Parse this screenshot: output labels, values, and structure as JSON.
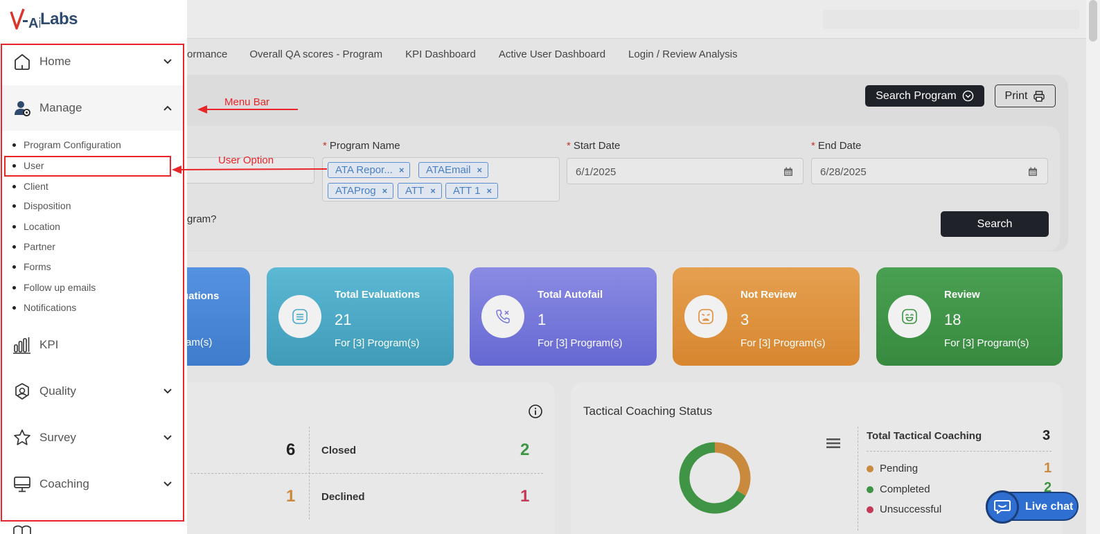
{
  "logo": {
    "text": "V-AiLabs"
  },
  "tabs": [
    "ormance",
    "Overall QA scores - Program",
    "KPI Dashboard",
    "Active User Dashboard",
    "Login / Review Analysis"
  ],
  "toolbar": {
    "search_program_label": "Search Program",
    "print_label": "Print"
  },
  "filters": {
    "program_name_label": "Program Name",
    "start_date_label": "Start Date",
    "end_date_label": "End Date",
    "start_date_value": "6/1/2025",
    "end_date_value": "6/28/2025",
    "program_chips": [
      "ATA Repor...",
      "ATAEmail",
      "ATAProg",
      "ATT",
      "ATT 1"
    ],
    "partial_question": "gram?",
    "search_label": "Search"
  },
  "cards": [
    {
      "title": "uations",
      "value": "",
      "sub": "ram(s)",
      "color": "#4a86d6"
    },
    {
      "title": "Total Evaluations",
      "value": "21",
      "sub": "For [3] Program(s)",
      "color": "#4aa9c7"
    },
    {
      "title": "Total Autofail",
      "value": "1",
      "sub": "For [3] Program(s)",
      "color": "#7577d9"
    },
    {
      "title": "Not Review",
      "value": "3",
      "sub": "For [3] Program(s)",
      "color": "#df8f3c"
    },
    {
      "title": "Review",
      "value": "18",
      "sub": "For [3] Program(s)",
      "color": "#3f9446"
    }
  ],
  "left_panel": {
    "row1_value": "6",
    "row1_right_label": "Closed",
    "row1_right_value": "2",
    "row2_value": "1",
    "row2_right_label": "Declined",
    "row2_right_value": "1"
  },
  "coaching": {
    "title": "Tactical Coaching Status",
    "total_label": "Total Tactical Coaching",
    "total_value": "3",
    "legend": [
      {
        "label": "Pending",
        "value": "1",
        "color": "#c98a3d"
      },
      {
        "label": "Completed",
        "value": "2",
        "color": "#3f9446"
      },
      {
        "label": "Unsuccessful",
        "value": "",
        "color": "#c23a57"
      }
    ],
    "chart_data": {
      "type": "pie",
      "categories": [
        "Pending",
        "Completed",
        "Unsuccessful"
      ],
      "values": [
        1,
        2,
        0
      ],
      "title": "Tactical Coaching Status"
    }
  },
  "livechat": {
    "label": "Live chat"
  },
  "sidebar": {
    "home_label": "Home",
    "manage_label": "Manage",
    "sub_items": [
      "Program Configuration",
      "User",
      "Client",
      "Disposition",
      "Location",
      "Partner",
      "Forms",
      "Follow up emails",
      "Notifications"
    ],
    "kpi_label": "KPI",
    "quality_label": "Quality",
    "survey_label": "Survey",
    "coaching_label": "Coaching"
  },
  "annotations": {
    "menu_bar": "Menu Bar",
    "user_option": "User Option"
  }
}
